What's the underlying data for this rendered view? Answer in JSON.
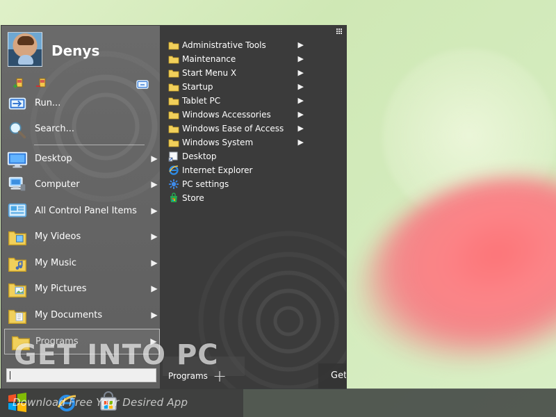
{
  "wallpaper": {
    "colors": {
      "green": "#d9efc6",
      "melon": "#ff6c73",
      "light": "#fffef0"
    }
  },
  "taskbar": {
    "start_label": "",
    "icons": [
      {
        "name": "windows-logo-icon"
      },
      {
        "name": "internet-explorer-icon"
      },
      {
        "name": "store-icon"
      }
    ]
  },
  "watermark": {
    "title": "GET INTO PC",
    "subtitle": "Download Free Your Desired App"
  },
  "start_menu": {
    "user_name": "Denys",
    "left_items": [
      {
        "label": "Run...",
        "icon": "run-icon"
      },
      {
        "label": "Search...",
        "icon": "search-icon"
      },
      {
        "label": "Desktop",
        "icon": "desktop-icon"
      },
      {
        "label": "Computer",
        "icon": "computer-icon"
      },
      {
        "label": "All Control Panel Items",
        "icon": "control-panel-icon"
      },
      {
        "label": "My Videos",
        "icon": "videos-folder-icon"
      },
      {
        "label": "My Music",
        "icon": "music-folder-icon"
      },
      {
        "label": "My Pictures",
        "icon": "pictures-folder-icon"
      },
      {
        "label": "My Documents",
        "icon": "documents-folder-icon"
      }
    ],
    "programs_label": "Programs",
    "right_items": [
      {
        "label": "Administrative Tools",
        "icon": "folder-icon",
        "submenu": true
      },
      {
        "label": "Maintenance",
        "icon": "folder-icon",
        "submenu": true
      },
      {
        "label": "Start Menu X",
        "icon": "folder-icon",
        "submenu": true
      },
      {
        "label": "Startup",
        "icon": "folder-icon",
        "submenu": true
      },
      {
        "label": "Tablet PC",
        "icon": "folder-icon",
        "submenu": true
      },
      {
        "label": "Windows Accessories",
        "icon": "folder-icon",
        "submenu": true
      },
      {
        "label": "Windows Ease of Access",
        "icon": "folder-icon",
        "submenu": true
      },
      {
        "label": "Windows System",
        "icon": "folder-icon",
        "submenu": true
      },
      {
        "label": "Desktop",
        "icon": "shortcut-icon",
        "submenu": false
      },
      {
        "label": "Internet Explorer",
        "icon": "internet-explorer-icon",
        "submenu": false
      },
      {
        "label": "PC settings",
        "icon": "settings-icon",
        "submenu": false
      },
      {
        "label": "Store",
        "icon": "store-icon",
        "submenu": false
      }
    ],
    "bottom_bar": {
      "programs_tab": "Programs",
      "get_pro": "Get PRO"
    },
    "colors": {
      "left_pane": "#666666",
      "right_pane": "#3b3b3b",
      "lock": "#f2a236",
      "power": "#36a145",
      "settings": "#f2a236"
    }
  }
}
